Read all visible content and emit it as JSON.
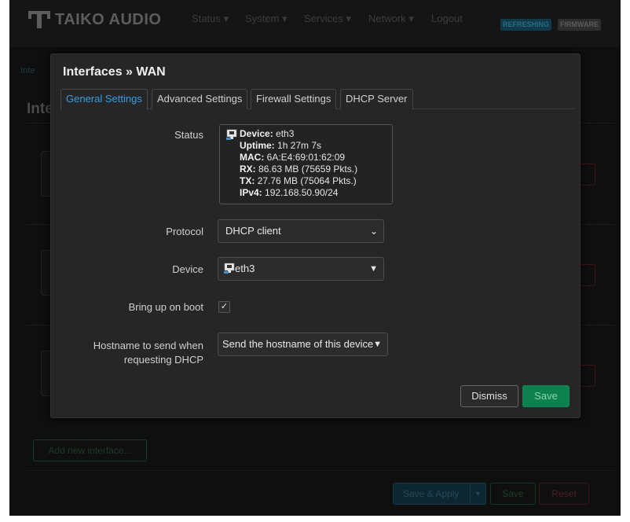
{
  "navbar": {
    "brand": "TAIKO AUDIO",
    "menu": [
      "Status",
      "System",
      "Services",
      "Network",
      "Logout"
    ],
    "badges": {
      "refreshing": "REFRESHING",
      "firmware": "FIRMWARE"
    }
  },
  "background": {
    "breadcrumb": "Inte",
    "title": "Inte",
    "add_interface": "Add new interface...",
    "footer": {
      "save_apply": "Save & Apply",
      "save": "Save",
      "reset": "Reset"
    }
  },
  "modal": {
    "title": "Interfaces » WAN",
    "tabs": [
      "General Settings",
      "Advanced Settings",
      "Firewall Settings",
      "DHCP Server"
    ],
    "active_tab": 0,
    "fields": {
      "status_label": "Status",
      "status": {
        "device_label": "Device:",
        "device": "eth3",
        "uptime_label": "Uptime:",
        "uptime": "1h 27m 7s",
        "mac_label": "MAC:",
        "mac": "6A:E4:69:01:62:09",
        "rx_label": "RX:",
        "rx": "86.63 MB (75659 Pkts.)",
        "tx_label": "TX:",
        "tx": "27.76 MB (75064 Pkts.)",
        "ipv4_label": "IPv4:",
        "ipv4": "192.168.50.90/24"
      },
      "protocol_label": "Protocol",
      "protocol_value": "DHCP client",
      "device_label": "Device",
      "device_value": "eth3",
      "boot_label": "Bring up on boot",
      "boot_checked": true,
      "hostname_label_1": "Hostname to send when",
      "hostname_label_2": "requesting DHCP",
      "hostname_value": "Send the hostname of this device"
    },
    "buttons": {
      "dismiss": "Dismiss",
      "save": "Save"
    }
  },
  "colors": {
    "accent": "#3a9ee0",
    "save_green": "#0d8050",
    "modal_bg": "#262626"
  }
}
